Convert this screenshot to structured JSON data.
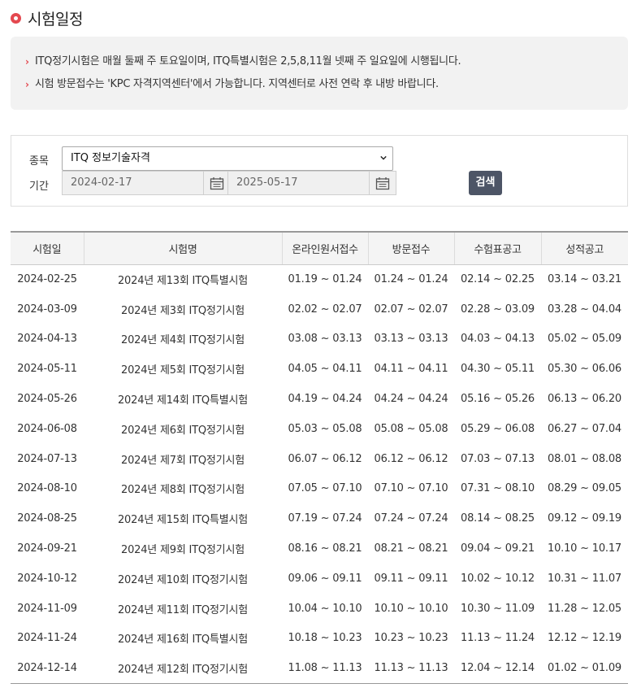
{
  "page": {
    "title": "시험일정"
  },
  "notice": {
    "lines": [
      "ITQ정기시험은 매월 둘째 주 토요일이며, ITQ특별시험은 2,5,8,11월 넷째 주 일요일에 시행됩니다.",
      "시험 방문접수는 'KPC 자격지역센터'에서 가능합니다. 지역센터로 사전 연락 후 내방 바랍니다."
    ]
  },
  "search": {
    "category_label": "종목",
    "category_value": "ITQ 정보기술자격",
    "period_label": "기간",
    "start_date": "2024-02-17",
    "end_date": "2025-05-17",
    "button_label": "검색"
  },
  "table": {
    "headers": [
      "시험일",
      "시험명",
      "온라인원서접수",
      "방문접수",
      "수험표공고",
      "성적공고"
    ],
    "rows": [
      [
        "2024-02-25",
        "2024년 제13회 ITQ특별시험",
        "01.19 ~ 01.24",
        "01.24 ~ 01.24",
        "02.14 ~ 02.25",
        "03.14 ~ 03.21"
      ],
      [
        "2024-03-09",
        "2024년 제3회 ITQ정기시험",
        "02.02 ~ 02.07",
        "02.07 ~ 02.07",
        "02.28 ~ 03.09",
        "03.28 ~ 04.04"
      ],
      [
        "2024-04-13",
        "2024년 제4회 ITQ정기시험",
        "03.08 ~ 03.13",
        "03.13 ~ 03.13",
        "04.03 ~ 04.13",
        "05.02 ~ 05.09"
      ],
      [
        "2024-05-11",
        "2024년 제5회 ITQ정기시험",
        "04.05 ~ 04.11",
        "04.11 ~ 04.11",
        "04.30 ~ 05.11",
        "05.30 ~ 06.06"
      ],
      [
        "2024-05-26",
        "2024년 제14회 ITQ특별시험",
        "04.19 ~ 04.24",
        "04.24 ~ 04.24",
        "05.16 ~ 05.26",
        "06.13 ~ 06.20"
      ],
      [
        "2024-06-08",
        "2024년 제6회 ITQ정기시험",
        "05.03 ~ 05.08",
        "05.08 ~ 05.08",
        "05.29 ~ 06.08",
        "06.27 ~ 07.04"
      ],
      [
        "2024-07-13",
        "2024년 제7회 ITQ정기시험",
        "06.07 ~ 06.12",
        "06.12 ~ 06.12",
        "07.03 ~ 07.13",
        "08.01 ~ 08.08"
      ],
      [
        "2024-08-10",
        "2024년 제8회 ITQ정기시험",
        "07.05 ~ 07.10",
        "07.10 ~ 07.10",
        "07.31 ~ 08.10",
        "08.29 ~ 09.05"
      ],
      [
        "2024-08-25",
        "2024년 제15회 ITQ특별시험",
        "07.19 ~ 07.24",
        "07.24 ~ 07.24",
        "08.14 ~ 08.25",
        "09.12 ~ 09.19"
      ],
      [
        "2024-09-21",
        "2024년 제9회 ITQ정기시험",
        "08.16 ~ 08.21",
        "08.21 ~ 08.21",
        "09.04 ~ 09.21",
        "10.10 ~ 10.17"
      ],
      [
        "2024-10-12",
        "2024년 제10회 ITQ정기시험",
        "09.06 ~ 09.11",
        "09.11 ~ 09.11",
        "10.02 ~ 10.12",
        "10.31 ~ 11.07"
      ],
      [
        "2024-11-09",
        "2024년 제11회 ITQ정기시험",
        "10.04 ~ 10.10",
        "10.10 ~ 10.10",
        "10.30 ~ 11.09",
        "11.28 ~ 12.05"
      ],
      [
        "2024-11-24",
        "2024년 제16회 ITQ특별시험",
        "10.18 ~ 10.23",
        "10.23 ~ 10.23",
        "11.13 ~ 11.24",
        "12.12 ~ 12.19"
      ],
      [
        "2024-12-14",
        "2024년 제12회 ITQ정기시험",
        "11.08 ~ 11.13",
        "11.13 ~ 11.13",
        "12.04 ~ 12.14",
        "01.02 ~ 01.09"
      ]
    ]
  },
  "colors": {
    "accent": "#e4484f",
    "button": "#4d5566",
    "notice_bg": "#f2f2f2"
  }
}
